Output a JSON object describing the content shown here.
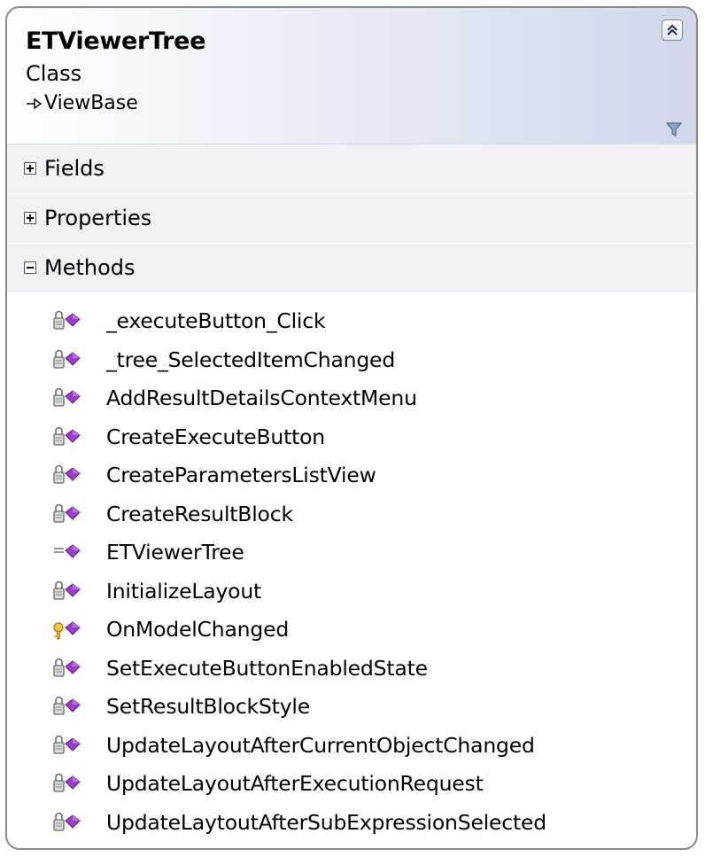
{
  "class": {
    "name": "ETViewerTree",
    "kind": "Class",
    "base": "ViewBase",
    "collapse_icon": "double-chevron-up-icon",
    "filter_icon": "filter-icon"
  },
  "sections": [
    {
      "label": "Fields",
      "expanded": false
    },
    {
      "label": "Properties",
      "expanded": false
    },
    {
      "label": "Methods",
      "expanded": true
    }
  ],
  "methods": [
    {
      "name": "_executeButton_Click",
      "access": "private"
    },
    {
      "name": "_tree_SelectedItemChanged",
      "access": "private"
    },
    {
      "name": "AddResultDetailsContextMenu",
      "access": "private"
    },
    {
      "name": "CreateExecuteButton",
      "access": "private"
    },
    {
      "name": "CreateParametersListView",
      "access": "private"
    },
    {
      "name": "CreateResultBlock",
      "access": "private"
    },
    {
      "name": "ETViewerTree",
      "access": "public"
    },
    {
      "name": "InitializeLayout",
      "access": "private"
    },
    {
      "name": "OnModelChanged",
      "access": "protected"
    },
    {
      "name": "SetExecuteButtonEnabledState",
      "access": "private"
    },
    {
      "name": "SetResultBlockStyle",
      "access": "private"
    },
    {
      "name": "UpdateLayoutAfterCurrentObjectChanged",
      "access": "private"
    },
    {
      "name": "UpdateLayoutAfterExecutionRequest",
      "access": "private"
    },
    {
      "name": "UpdateLaytoutAfterSubExpressionSelected",
      "access": "private"
    }
  ],
  "colors": {
    "method_purple": "#9b3fc8",
    "border": "#8a8a8a",
    "header_gradient_end": "#cfd7ea",
    "section_bg": "#f0f1f5"
  }
}
